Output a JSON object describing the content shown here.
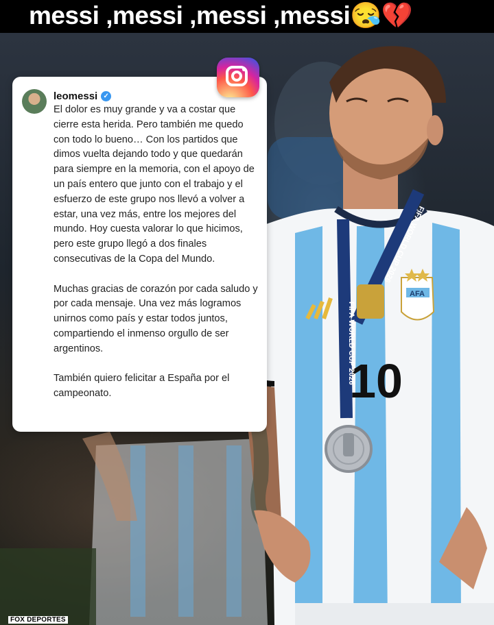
{
  "header": {
    "title": "messi ,messi ,messi ,messi😪💔"
  },
  "post": {
    "username": "leomessi",
    "verified_icon": "verified-badge-icon",
    "paragraphs": [
      "El dolor es muy grande y va a costar que cierre esta herida. Pero también me quedo con todo lo bueno… Con los partidos que dimos vuelta dejando todo y que quedarán para siempre en la memoria, con el apoyo de un país entero que junto con el trabajo y el esfuerzo de este grupo nos llevó a volver a estar, una vez más, entre los mejores del mundo. Hoy cuesta valorar lo que hicimos, pero este grupo llegó a dos finales consecutivas de la Copa del Mundo.",
      "Muchas gracias de corazón por cada saludo y por cada mensaje. Una vez más logramos unirnos como país y estar todos juntos, compartiendo el inmenso orgullo de ser argentinos.",
      "También quiero felicitar a España por el campeonato."
    ]
  },
  "photo": {
    "lanyard_text_1": "FIFA WORLD CUP 2026",
    "lanyard_text_2": "FIFA WORLD CUP 2026",
    "badge_text": "AFA",
    "shirt_number": "10"
  },
  "watermark": "FOX DEPORTES",
  "colors": {
    "instagram_gradient": [
      "#fdf497",
      "#fd5949",
      "#d6249f",
      "#285AEB"
    ],
    "jersey_blue": "#6fb8e6",
    "jersey_white": "#f4f6f8",
    "verified_blue": "#3897f0"
  }
}
